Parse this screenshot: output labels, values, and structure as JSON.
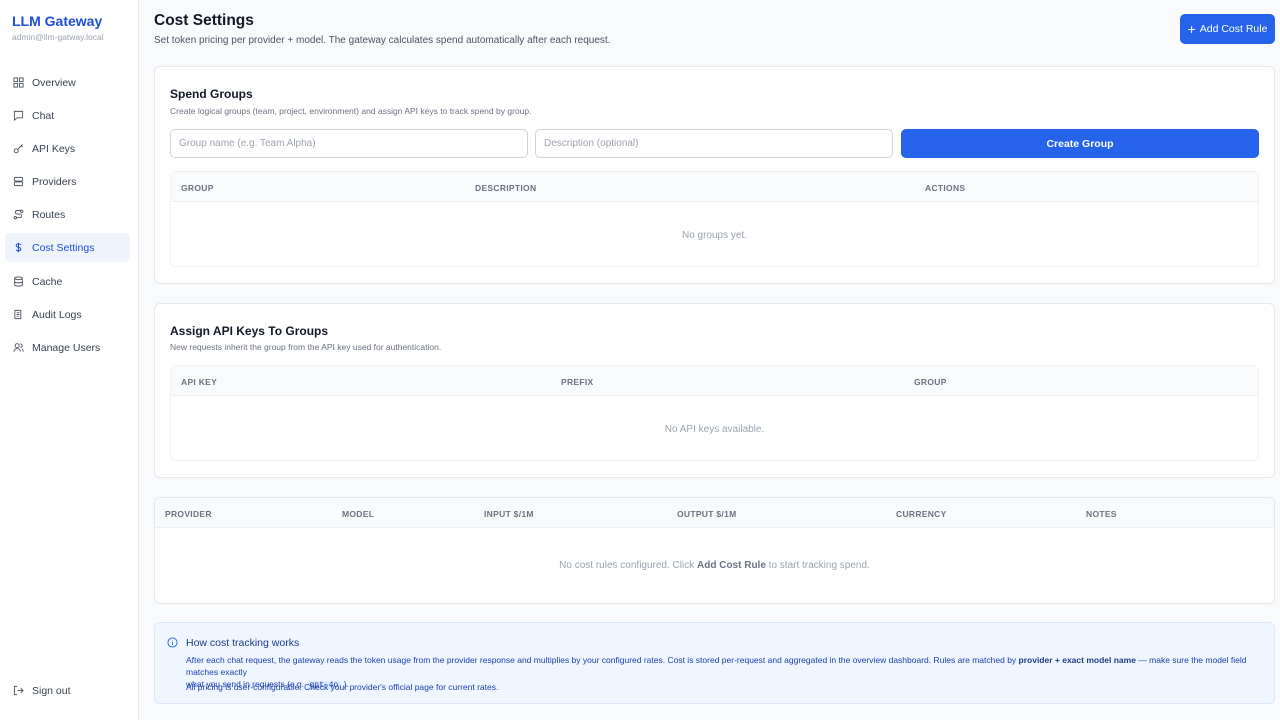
{
  "brand": {
    "title": "LLM Gateway",
    "user": "admin@llm-gatway.local"
  },
  "nav": [
    {
      "label": "Overview",
      "icon": "grid-icon"
    },
    {
      "label": "Chat",
      "icon": "chat-icon"
    },
    {
      "label": "API Keys",
      "icon": "key-icon"
    },
    {
      "label": "Providers",
      "icon": "server-icon"
    },
    {
      "label": "Routes",
      "icon": "route-icon"
    },
    {
      "label": "Cost Settings",
      "icon": "dollar-icon",
      "active": true
    },
    {
      "label": "Cache",
      "icon": "database-icon"
    },
    {
      "label": "Audit Logs",
      "icon": "scroll-icon"
    },
    {
      "label": "Manage Users",
      "icon": "users-icon"
    }
  ],
  "signout": {
    "label": "Sign out",
    "icon": "logout-icon"
  },
  "header": {
    "title": "Cost Settings",
    "subtitle": "Set token pricing per provider + model. The gateway calculates spend automatically after each request.",
    "add_button": "Add Cost Rule"
  },
  "spend_groups": {
    "title": "Spend Groups",
    "subtitle": "Create logical groups (team, project, environment) and assign API keys to track spend by group.",
    "name_placeholder": "Group name (e.g. Team Alpha)",
    "desc_placeholder": "Description (optional)",
    "create_button": "Create Group",
    "columns": [
      "GROUP",
      "DESCRIPTION",
      "ACTIONS"
    ],
    "empty": "No groups yet."
  },
  "assign": {
    "title": "Assign API Keys To Groups",
    "subtitle": "New requests inherit the group from the API key used for authentication.",
    "columns": [
      "API KEY",
      "PREFIX",
      "GROUP"
    ],
    "empty": "No API keys available."
  },
  "rules": {
    "columns": [
      "PROVIDER",
      "MODEL",
      "INPUT $/1M",
      "OUTPUT $/1M",
      "CURRENCY",
      "NOTES"
    ],
    "empty_pre": "No cost rules configured. Click ",
    "empty_strong": "Add Cost Rule",
    "empty_post": " to start tracking spend."
  },
  "info": {
    "title": "How cost tracking works",
    "line1_pre": "After each chat request, the gateway reads the token usage from the provider response and multiplies by your configured rates. Cost is stored per-request and aggregated in the overview dashboard. Rules are matched by ",
    "line1_strong": "provider + exact model name",
    "line1_post": " — make sure the model field matches exactly",
    "line2_pre": "what you send in requests (e.g. ",
    "line2_code": "gpt-4o",
    "line2_post": " ).",
    "line3": "All pricing is user-configurable. Check your provider's official page for current rates."
  },
  "colors": {
    "accent": "#2563eb",
    "brand": "#1d4ed8",
    "active_bg": "#eef3fc"
  }
}
